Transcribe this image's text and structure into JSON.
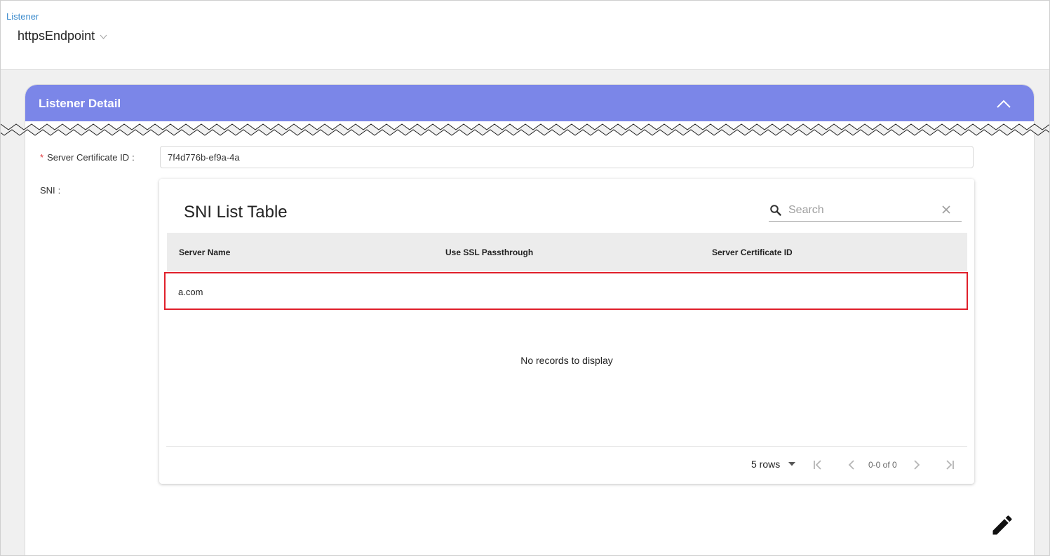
{
  "header": {
    "breadcrumb": "Listener",
    "selector_value": "httpsEndpoint"
  },
  "card": {
    "title": "Listener Detail"
  },
  "form": {
    "cert_label": "Server Certificate ID",
    "cert_colon": ":",
    "required_mark": "*",
    "cert_value": "7f4d776b-ef9a-4a",
    "sni_label": "SNI",
    "sni_colon": ":"
  },
  "sni_table": {
    "title": "SNI List Table",
    "search_placeholder": "Search",
    "columns": [
      "Server Name",
      "Use SSL Passthrough",
      "Server Certificate ID"
    ],
    "rows": [
      {
        "server_name": "a.com",
        "use_ssl_passthrough": "",
        "server_certificate_id": ""
      }
    ],
    "empty_message": "No records to display",
    "rows_per_page": "5 rows",
    "page_info": "0-0 of 0"
  },
  "colors": {
    "card_header": "#7b86e8",
    "breadcrumb": "#3d8ccd",
    "highlight_border": "#e0202b",
    "required": "#e0393e"
  },
  "icons": [
    "chevron-down-icon",
    "chevron-up-icon",
    "search-icon",
    "close-icon",
    "caret-down-icon",
    "first-page-icon",
    "previous-page-icon",
    "next-page-icon",
    "last-page-icon",
    "pencil-icon"
  ]
}
